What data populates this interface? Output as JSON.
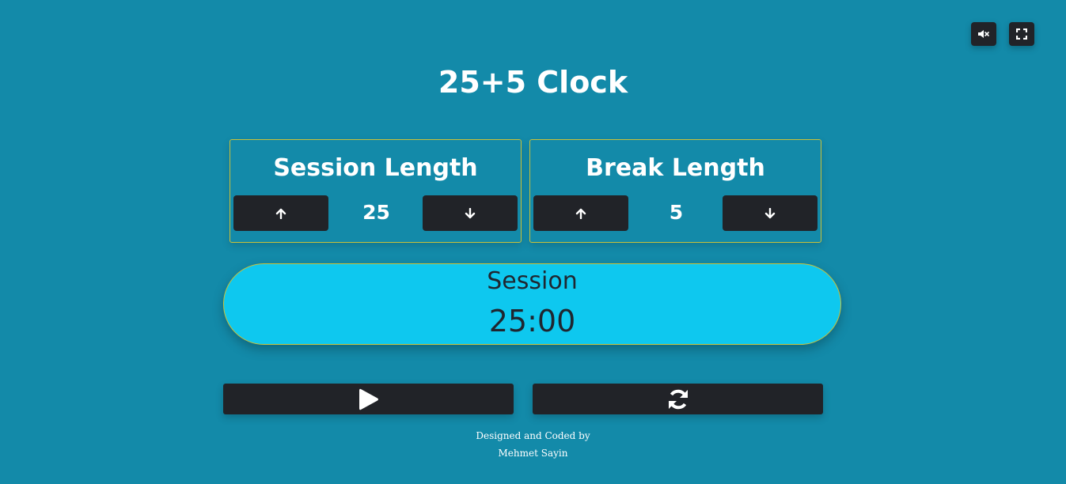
{
  "header": {
    "title": "25+5 Clock",
    "mute_icon": "volume-mute-icon",
    "fullscreen_icon": "fullscreen-icon"
  },
  "session": {
    "label": "Session Length",
    "value": "25",
    "increment_icon": "arrow-up-icon",
    "decrement_icon": "arrow-down-icon"
  },
  "break": {
    "label": "Break Length",
    "value": "5",
    "increment_icon": "arrow-up-icon",
    "decrement_icon": "arrow-down-icon"
  },
  "timer": {
    "label": "Session",
    "time": "25:00"
  },
  "controls": {
    "start_icon": "play-icon",
    "reset_icon": "refresh-icon"
  },
  "footer": {
    "line1": "Designed and Coded by",
    "line2": "Mehmet Sayin"
  },
  "colors": {
    "background": "#138aa9",
    "timer_background": "#0ec8ef",
    "button": "#212328",
    "border": "#c9c23a"
  }
}
